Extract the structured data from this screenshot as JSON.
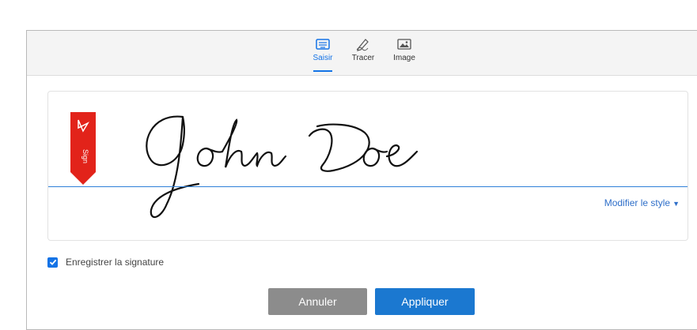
{
  "tabs": [
    {
      "label": "Saisir",
      "icon": "keyboard-icon",
      "active": true
    },
    {
      "label": "Tracer",
      "icon": "pen-draw-icon",
      "active": false
    },
    {
      "label": "Image",
      "icon": "image-icon",
      "active": false
    }
  ],
  "signature": {
    "name": "John Doe",
    "tag_text": "Sign",
    "line_color": "#2f80d8"
  },
  "style_link": {
    "label": "Modifier le style"
  },
  "save_signature": {
    "label": "Enregistrer la signature",
    "checked": true
  },
  "buttons": {
    "cancel": "Annuler",
    "apply": "Appliquer"
  },
  "colors": {
    "accent": "#1473e6",
    "adobe_red": "#e2231a",
    "cancel_gray": "#8c8c8c"
  }
}
